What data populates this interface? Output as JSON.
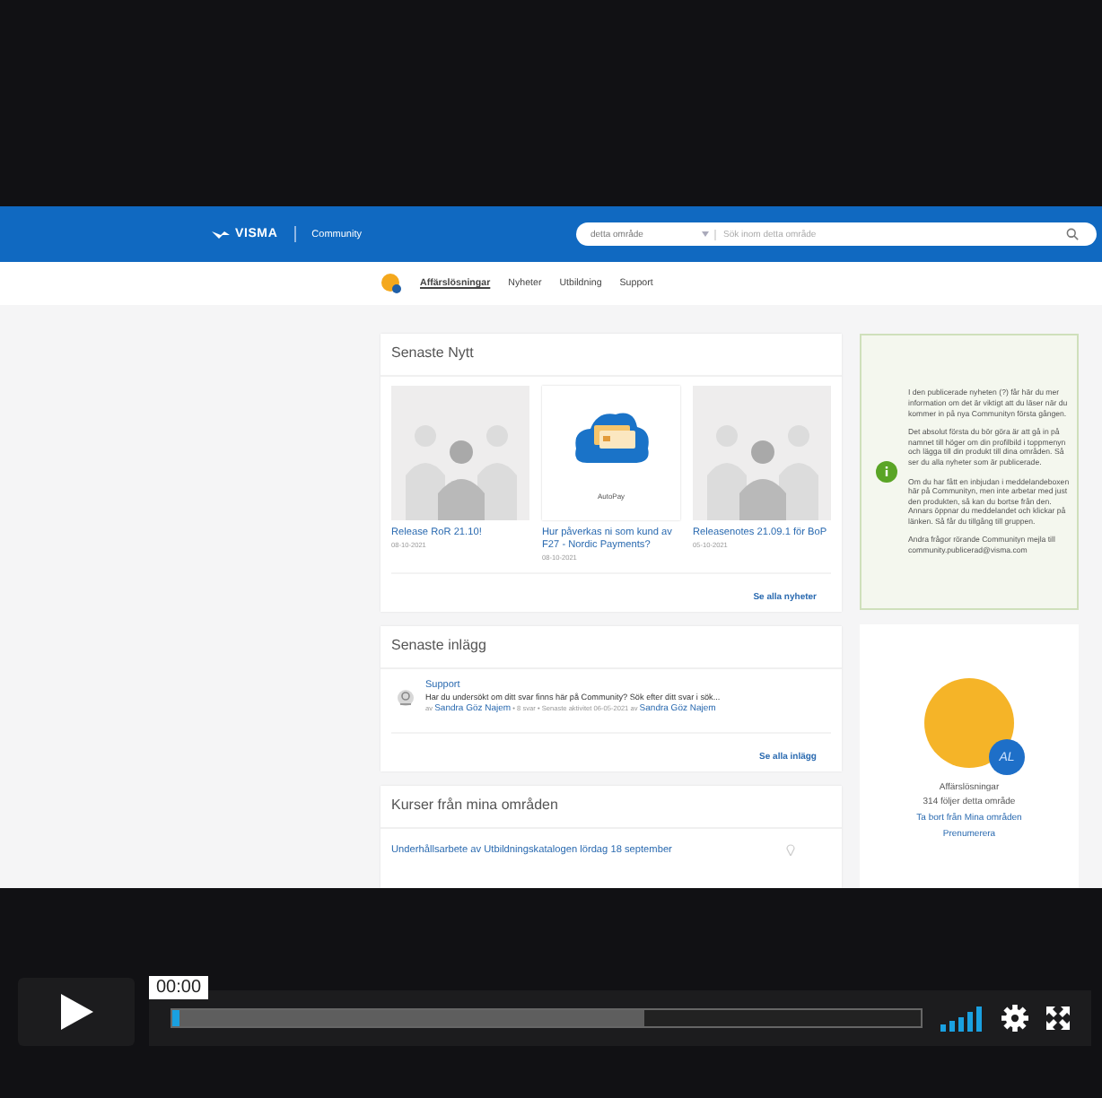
{
  "header": {
    "brand": "VISMA",
    "site": "Community",
    "scope": "detta område",
    "placeholder": "Sök inom detta område"
  },
  "nav": [
    {
      "label": "Affärslösningar",
      "selected": true
    },
    {
      "label": "Nyheter",
      "selected": false
    },
    {
      "label": "Utbildning",
      "selected": false
    },
    {
      "label": "Support",
      "selected": false
    }
  ],
  "news": {
    "title": "Senaste Nytt",
    "items": [
      {
        "kind": "people",
        "title": "Release RoR 21.10!",
        "date": "08-10-2021"
      },
      {
        "kind": "cloud",
        "caption": "AutoPay",
        "title": "Hur påverkas ni som kund av F27 - Nordic Payments?",
        "date": "08-10-2021"
      },
      {
        "kind": "people",
        "title": "Releasenotes 21.09.1 för BoP",
        "date": "05-10-2021"
      }
    ],
    "more": "Se alla nyheter"
  },
  "posts": {
    "title": "Senaste inlägg",
    "items": [
      {
        "board": "Support",
        "text": "Har du undersökt om ditt svar finns här på Community? Sök efter ditt svar i sök...",
        "prefix": "av",
        "author": "Sandra Göz Najem",
        "middle": "• 8 svar • Senaste aktivitet 06-05-2021 av",
        "last_author": "Sandra Göz Najem"
      }
    ],
    "more": "Se alla inlägg"
  },
  "courses": {
    "title": "Kurser från mina områden",
    "items": [
      {
        "title": "Underhållsarbete av Utbildningskatalogen lördag 18 september"
      }
    ]
  },
  "info": {
    "paragraphs": [
      "I den publicerade nyheten (?) får här du mer information om det är viktigt att du läser när du kommer in på nya Communityn första gången.",
      "Det absolut första du bör göra är att gå in på namnet till höger om din profilbild i toppmenyn och lägga till din produkt till dina områden. Så ser du alla nyheter som är publicerade.",
      "Om du har fått en inbjudan i meddelandeboxen här på Communityn, men inte arbetar med just den produkten, så kan du bortse från den. Annars öppnar du meddelandet och klickar på länken. Så får du tillgång till gruppen.",
      "Andra frågor rörande Communityn mejla till community.publicerad@visma.com"
    ]
  },
  "area": {
    "badge": "AL",
    "name": "Affärslösningar",
    "followers": "314 följer detta område",
    "links": [
      "Ta bort från Mina områden",
      "Prenumerera"
    ]
  },
  "player": {
    "time": "00:00",
    "progress": {
      "level": 0.01
    },
    "buffer": {
      "level": 0.63
    }
  }
}
